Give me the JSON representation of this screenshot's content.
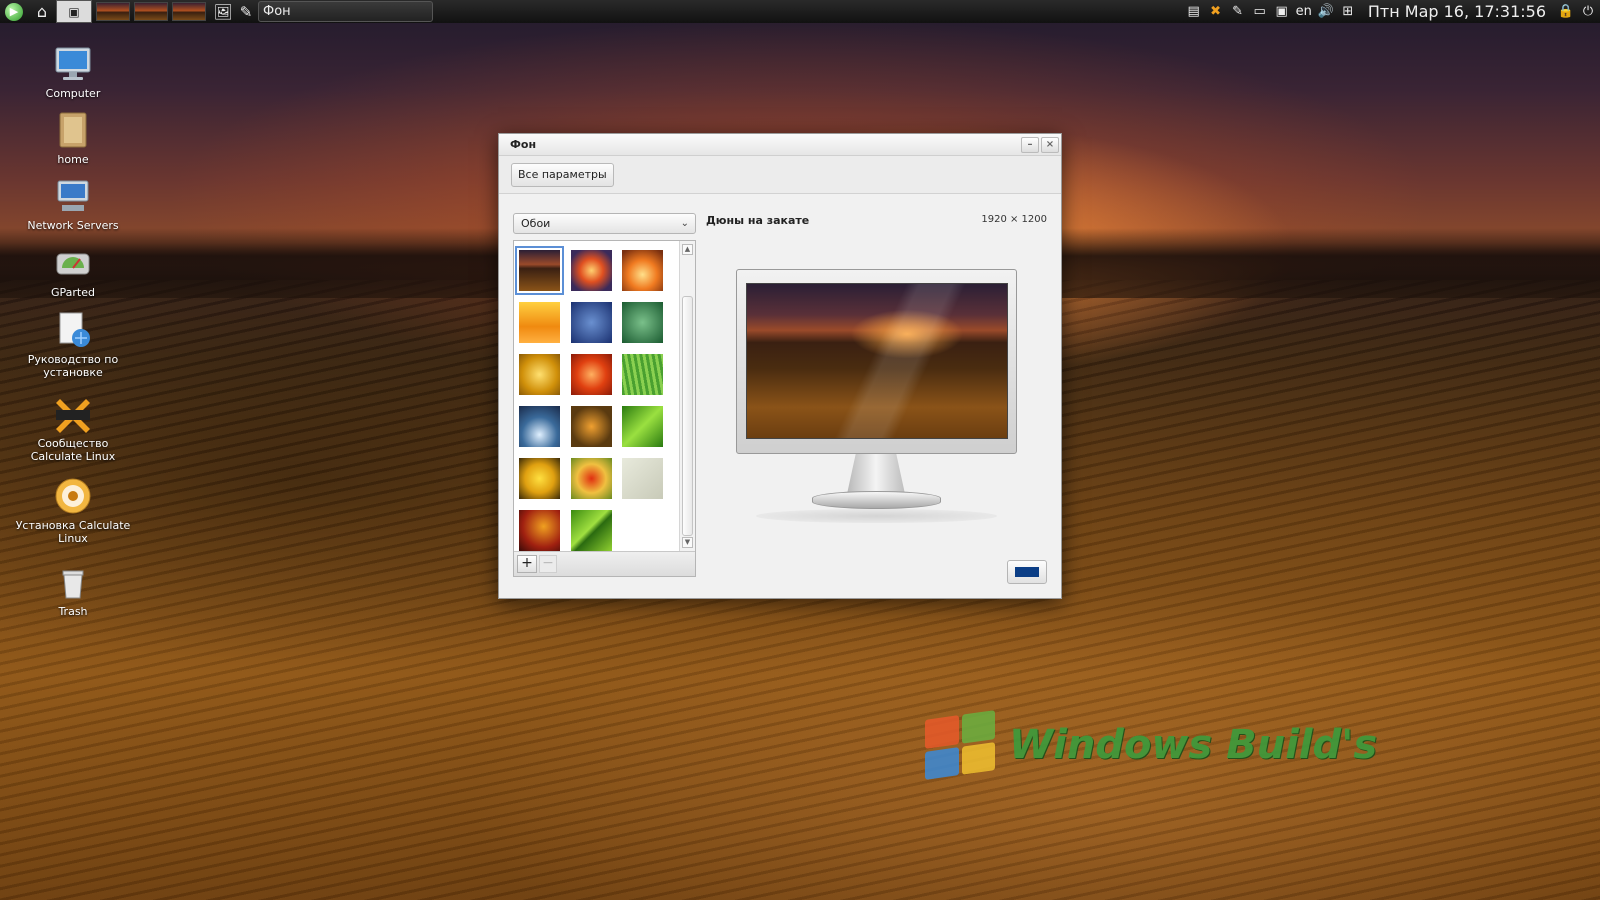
{
  "panel": {
    "task_title": "Фон",
    "lang": "en",
    "clock": "Птн Мар 16, 17:31:56"
  },
  "desktop": {
    "icons": [
      {
        "label": "Computer",
        "icon": "computer-icon"
      },
      {
        "label": "home",
        "icon": "home-folder-icon"
      },
      {
        "label": "Network Servers",
        "icon": "network-servers-icon"
      },
      {
        "label": "GParted",
        "icon": "gparted-icon"
      },
      {
        "label": "Руководство по установке",
        "icon": "install-guide-icon"
      },
      {
        "label": "Сообщество Calculate Linux",
        "icon": "community-chat-icon"
      },
      {
        "label": "Установка Calculate Linux",
        "icon": "installer-icon"
      },
      {
        "label": "Trash",
        "icon": "trash-icon"
      }
    ]
  },
  "window": {
    "title": "Фон",
    "all_settings_label": "Все параметры",
    "source_dropdown": "Обои",
    "selected_wallpaper": {
      "name": "Дюны на закате",
      "size": "1920 × 1200"
    },
    "add_label": "+",
    "remove_label": "−",
    "bg_color": "#0b3e86"
  },
  "watermark": {
    "text": "Windows Build's"
  },
  "colors": {
    "accent_selection": "#5b8fd6",
    "watermark_green": "#3c9b3c"
  }
}
